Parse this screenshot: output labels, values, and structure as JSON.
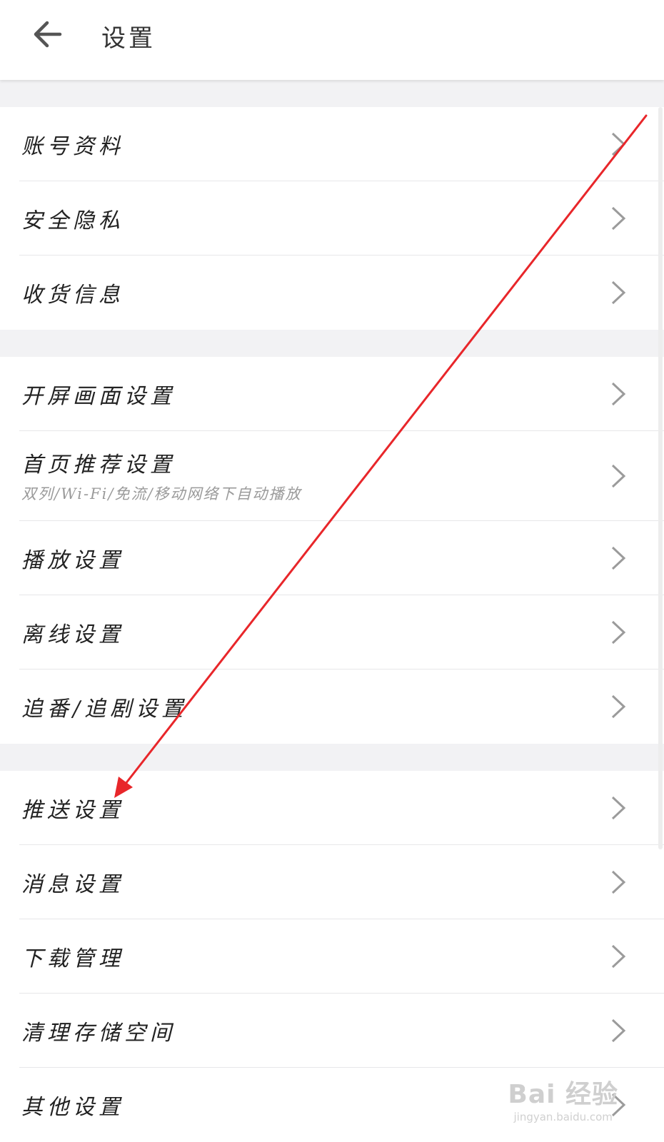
{
  "header": {
    "title": "设置",
    "back_icon": "arrow-left-icon"
  },
  "groups": [
    {
      "items": [
        {
          "label": "账号资料"
        },
        {
          "label": "安全隐私"
        },
        {
          "label": "收货信息"
        }
      ]
    },
    {
      "items": [
        {
          "label": "开屏画面设置"
        },
        {
          "label": "首页推荐设置",
          "subtitle": "双列/Wi-Fi/免流/移动网络下自动播放"
        },
        {
          "label": "播放设置"
        },
        {
          "label": "离线设置"
        },
        {
          "label": "追番/追剧设置"
        }
      ]
    },
    {
      "items": [
        {
          "label": "推送设置"
        },
        {
          "label": "消息设置"
        },
        {
          "label": "下载管理"
        },
        {
          "label": "清理存储空间"
        },
        {
          "label": "其他设置"
        }
      ]
    }
  ],
  "annotation": {
    "color": "#e8262a"
  },
  "watermark": {
    "main": "Bai 经验",
    "sub": "jingyan.baidu.com"
  },
  "colors": {
    "divider": "#e7e7e9",
    "gap": "#f2f2f4",
    "chevron": "#9b9b9b"
  }
}
